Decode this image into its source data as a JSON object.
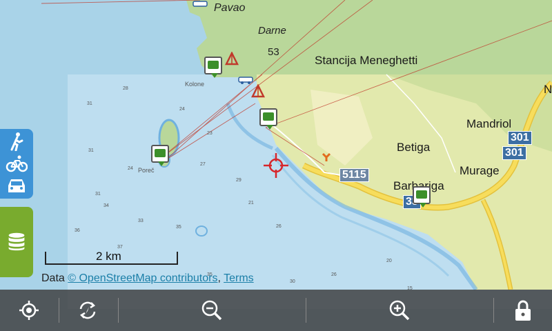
{
  "map": {
    "places": [
      {
        "name": "Pavao"
      },
      {
        "name": "Darne"
      },
      {
        "name": "53"
      },
      {
        "name": "Stancija Meneghetti"
      },
      {
        "name": "Mandriol"
      },
      {
        "name": "Betiga"
      },
      {
        "name": "Murage"
      },
      {
        "name": "Barbariga"
      },
      {
        "name": "N"
      },
      {
        "name": "Kolone"
      },
      {
        "name": "Poreč"
      }
    ],
    "roads": [
      "301",
      "301",
      "5115",
      "33"
    ],
    "colors": {
      "sea": "#a9d3e8",
      "land_forest": "#b9d79a",
      "land_farm": "#e9edb4",
      "road_yellow": "#f2d247",
      "track_red": "#c0392b"
    }
  },
  "scale": {
    "label": "2 km"
  },
  "attribution": {
    "prefix": "Data ",
    "osm_link": "© OpenStreetMap contributors",
    "sep": ", ",
    "terms_link": "Terms"
  },
  "side_panel": {
    "modes": [
      "hiking-icon",
      "cycling-icon",
      "car-icon"
    ],
    "database": "database-icon"
  },
  "toolbar": {
    "buttons": [
      "my-location-icon",
      "rotate-map-icon",
      "zoom-out-icon",
      "zoom-in-icon",
      "lock-icon"
    ]
  }
}
